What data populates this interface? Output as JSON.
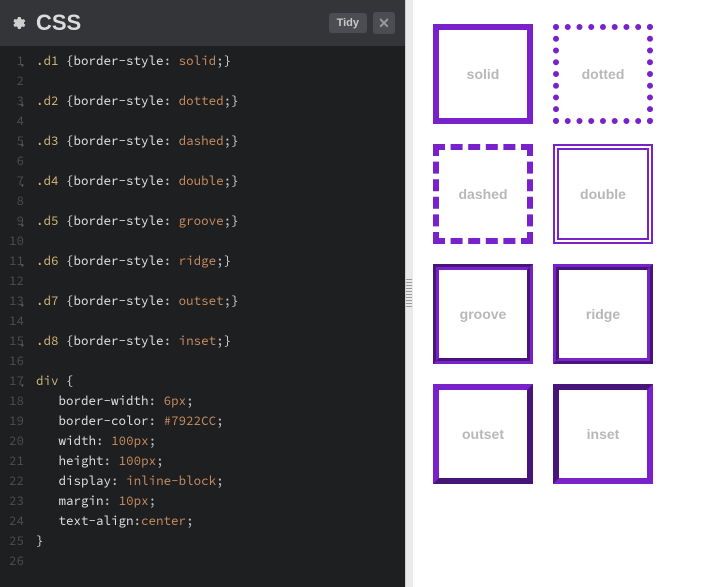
{
  "header": {
    "title": "CSS",
    "tidy_label": "Tidy",
    "close_label": "✕"
  },
  "code": {
    "lines": [
      {
        "n": "1",
        "fold": true,
        "t": "sel",
        "sel": ".d1",
        "prop": "border-style",
        "val": "solid"
      },
      {
        "n": "2",
        "t": "blank"
      },
      {
        "n": "3",
        "fold": true,
        "t": "sel",
        "sel": ".d2",
        "prop": "border-style",
        "val": "dotted"
      },
      {
        "n": "4",
        "t": "blank"
      },
      {
        "n": "5",
        "fold": true,
        "t": "sel",
        "sel": ".d3",
        "prop": "border-style",
        "val": "dashed"
      },
      {
        "n": "6",
        "t": "blank"
      },
      {
        "n": "7",
        "fold": true,
        "t": "sel",
        "sel": ".d4",
        "prop": "border-style",
        "val": "double"
      },
      {
        "n": "8",
        "t": "blank"
      },
      {
        "n": "9",
        "fold": true,
        "t": "sel",
        "sel": ".d5",
        "prop": "border-style",
        "val": "groove"
      },
      {
        "n": "10",
        "t": "blank"
      },
      {
        "n": "11",
        "fold": true,
        "t": "sel",
        "sel": ".d6",
        "prop": "border-style",
        "val": "ridge"
      },
      {
        "n": "12",
        "t": "blank"
      },
      {
        "n": "13",
        "fold": true,
        "t": "sel",
        "sel": ".d7",
        "prop": "border-style",
        "val": "outset"
      },
      {
        "n": "14",
        "t": "blank"
      },
      {
        "n": "15",
        "fold": true,
        "t": "sel",
        "sel": ".d8",
        "prop": "border-style",
        "val": "inset"
      },
      {
        "n": "16",
        "t": "blank"
      },
      {
        "n": "17",
        "fold": true,
        "t": "open",
        "sel": "div"
      },
      {
        "n": "18",
        "t": "decl",
        "prop": "border-width",
        "val": "6px"
      },
      {
        "n": "19",
        "t": "decl",
        "prop": "border-color",
        "val": "#7922CC"
      },
      {
        "n": "20",
        "t": "decl",
        "prop": "width",
        "val": "100px"
      },
      {
        "n": "21",
        "t": "decl",
        "prop": "height",
        "val": "100px"
      },
      {
        "n": "22",
        "t": "decl",
        "prop": "display",
        "val": "inline-block"
      },
      {
        "n": "23",
        "t": "decl",
        "prop": "margin",
        "val": "10px"
      },
      {
        "n": "24",
        "t": "decl",
        "prop": "text-align",
        "val": "center",
        "nospace": true
      },
      {
        "n": "25",
        "t": "close"
      },
      {
        "n": "26",
        "t": "blank"
      }
    ]
  },
  "preview": {
    "boxes": [
      {
        "label": "solid",
        "cls": "solid"
      },
      {
        "label": "dotted",
        "cls": "dotted"
      },
      {
        "label": "dashed",
        "cls": "dashed"
      },
      {
        "label": "double",
        "cls": "double"
      },
      {
        "label": "groove",
        "cls": "groove"
      },
      {
        "label": "ridge",
        "cls": "ridge"
      },
      {
        "label": "outset",
        "cls": "outset"
      },
      {
        "label": "inset",
        "cls": "inset"
      }
    ]
  }
}
